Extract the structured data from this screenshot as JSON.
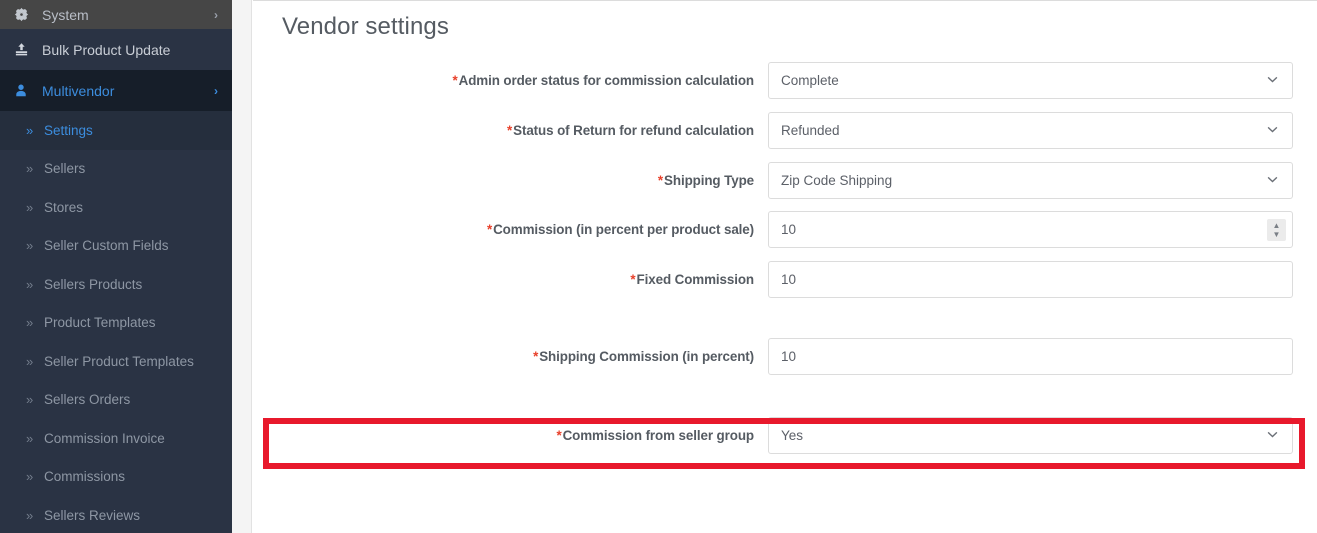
{
  "sidebar": {
    "top_item": {
      "label": "System",
      "icon": "gear-icon",
      "caret": "›"
    },
    "items": [
      {
        "label": "Bulk Product Update",
        "icon": "upload-icon",
        "caret": ""
      },
      {
        "label": "Multivendor",
        "icon": "user-icon",
        "caret": "›"
      }
    ],
    "sub_items": [
      {
        "label": "Settings",
        "chevron": "»"
      },
      {
        "label": "Sellers",
        "chevron": "»"
      },
      {
        "label": "Stores",
        "chevron": "»"
      },
      {
        "label": "Seller Custom Fields",
        "chevron": "»"
      },
      {
        "label": "Sellers Products",
        "chevron": "»"
      },
      {
        "label": "Product Templates",
        "chevron": "»"
      },
      {
        "label": "Seller Product Templates",
        "chevron": "»"
      },
      {
        "label": "Sellers Orders",
        "chevron": "»"
      },
      {
        "label": "Commission Invoice",
        "chevron": "»"
      },
      {
        "label": "Commissions",
        "chevron": "»"
      },
      {
        "label": "Sellers Reviews",
        "chevron": "»"
      }
    ]
  },
  "main": {
    "title": "Vendor settings",
    "required_marker": "*",
    "chevron_down": "⌄",
    "spinner_up": "▲",
    "spinner_down": "▼",
    "fields": [
      {
        "label": "Admin order status for commission calculation",
        "value": "Complete",
        "type": "select",
        "required": true
      },
      {
        "label": "Status of Return for refund calculation",
        "value": "Refunded",
        "type": "select",
        "required": true
      },
      {
        "label": "Shipping Type",
        "value": "Zip Code Shipping",
        "type": "select",
        "required": true
      },
      {
        "label": "Commission (in percent per product sale)",
        "value": "10",
        "type": "number",
        "required": true
      },
      {
        "label": "Fixed Commission",
        "value": "10",
        "type": "text",
        "required": true
      },
      {
        "label": "Shipping Commission (in percent)",
        "value": "10",
        "type": "text",
        "required": true,
        "highlighted": true
      },
      {
        "label": "Commission from seller group",
        "value": "Yes",
        "type": "select",
        "required": true
      }
    ]
  },
  "colors": {
    "sidebar_bg": "#2a3344",
    "sidebar_top_bg": "#464646",
    "sidebar_active_bg": "#161e29",
    "accent_blue": "#3c8dde",
    "required_red": "#e8402a",
    "highlight_red": "#e8192c",
    "gutter_bg": "#f4f4f4",
    "label_text": "#555b62"
  }
}
